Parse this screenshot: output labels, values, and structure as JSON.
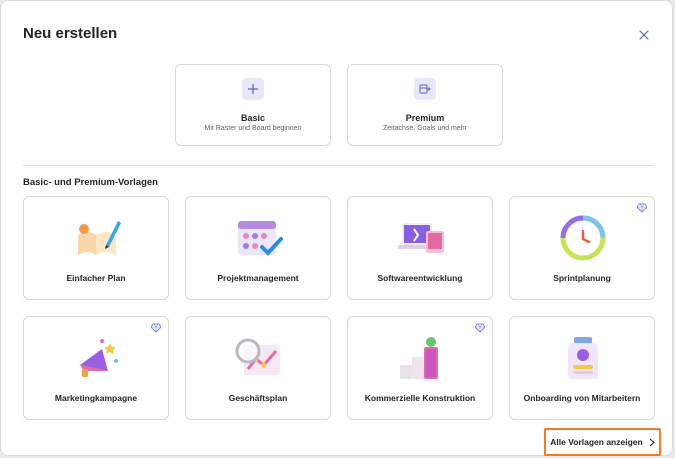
{
  "dialog": {
    "title": "Neu erstellen",
    "close_icon": "close-icon"
  },
  "top_options": [
    {
      "name": "Basic",
      "subtitle": "Mit Raster und Board beginnen",
      "icon": "plus-icon"
    },
    {
      "name": "Premium",
      "subtitle": "Zeitachse, Goals und mehr",
      "icon": "premium-board-icon"
    }
  ],
  "section_title": "Basic- und Premium-Vorlagen",
  "templates": [
    {
      "label": "Einfacher Plan",
      "premium": false,
      "icon": "book-pen-illustration"
    },
    {
      "label": "Projektmanagement",
      "premium": false,
      "icon": "calendar-check-illustration"
    },
    {
      "label": "Softwareentwicklung",
      "premium": false,
      "icon": "devices-illustration"
    },
    {
      "label": "Sprintplanung",
      "premium": true,
      "icon": "clock-ring-illustration"
    },
    {
      "label": "Marketingkampagne",
      "premium": true,
      "icon": "megaphone-illustration"
    },
    {
      "label": "Geschäftsplan",
      "premium": false,
      "icon": "chart-magnifier-illustration"
    },
    {
      "label": "Kommerzielle Konstruktion",
      "premium": true,
      "icon": "building-blocks-illustration"
    },
    {
      "label": "Onboarding von Mitarbeitern",
      "premium": false,
      "icon": "badge-illustration"
    }
  ],
  "footer": {
    "show_all_label": "Alle Vorlagen anzeigen",
    "chevron_icon": "chevron-right-icon"
  },
  "colors": {
    "accent": "#5b5fc7",
    "highlight_border": "#f27a2a",
    "gem": "#7b83eb"
  }
}
